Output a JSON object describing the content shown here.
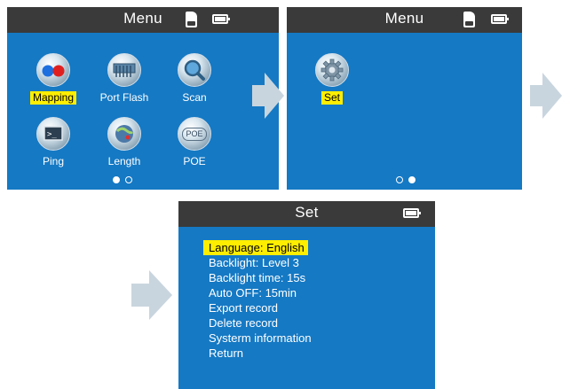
{
  "screen1": {
    "title": "Menu",
    "items": [
      {
        "label": "Mapping",
        "icon": "mapping-icon",
        "selected": true
      },
      {
        "label": "Port Flash",
        "icon": "port-flash-icon",
        "selected": false
      },
      {
        "label": "Scan",
        "icon": "scan-icon",
        "selected": false
      },
      {
        "label": "Ping",
        "icon": "ping-icon",
        "selected": false
      },
      {
        "label": "Length",
        "icon": "length-icon",
        "selected": false
      },
      {
        "label": "POE",
        "icon": "poe-icon",
        "selected": false
      }
    ],
    "page_indicator": {
      "pages": 2,
      "active": 1
    }
  },
  "screen2": {
    "title": "Menu",
    "items": [
      {
        "label": "Set",
        "icon": "gear-icon",
        "selected": true
      }
    ],
    "page_indicator": {
      "pages": 2,
      "active": 2
    }
  },
  "screen3": {
    "title": "Set",
    "items": [
      {
        "label": "Language: English",
        "selected": true
      },
      {
        "label": "Backlight: Level 3",
        "selected": false
      },
      {
        "label": "Backlight time: 15s",
        "selected": false
      },
      {
        "label": "Auto OFF: 15min",
        "selected": false
      },
      {
        "label": "Export record",
        "selected": false
      },
      {
        "label": "Delete record",
        "selected": false
      },
      {
        "label": "Systerm information",
        "selected": false
      },
      {
        "label": "Return",
        "selected": false
      }
    ]
  },
  "poe_icon_text": "POE",
  "colors": {
    "screen_bg": "#1579c4",
    "title_bar": "#3a3a3a",
    "highlight": "#ffee00",
    "arrow": "#c9d5de",
    "page_bg": "#ffffff"
  }
}
